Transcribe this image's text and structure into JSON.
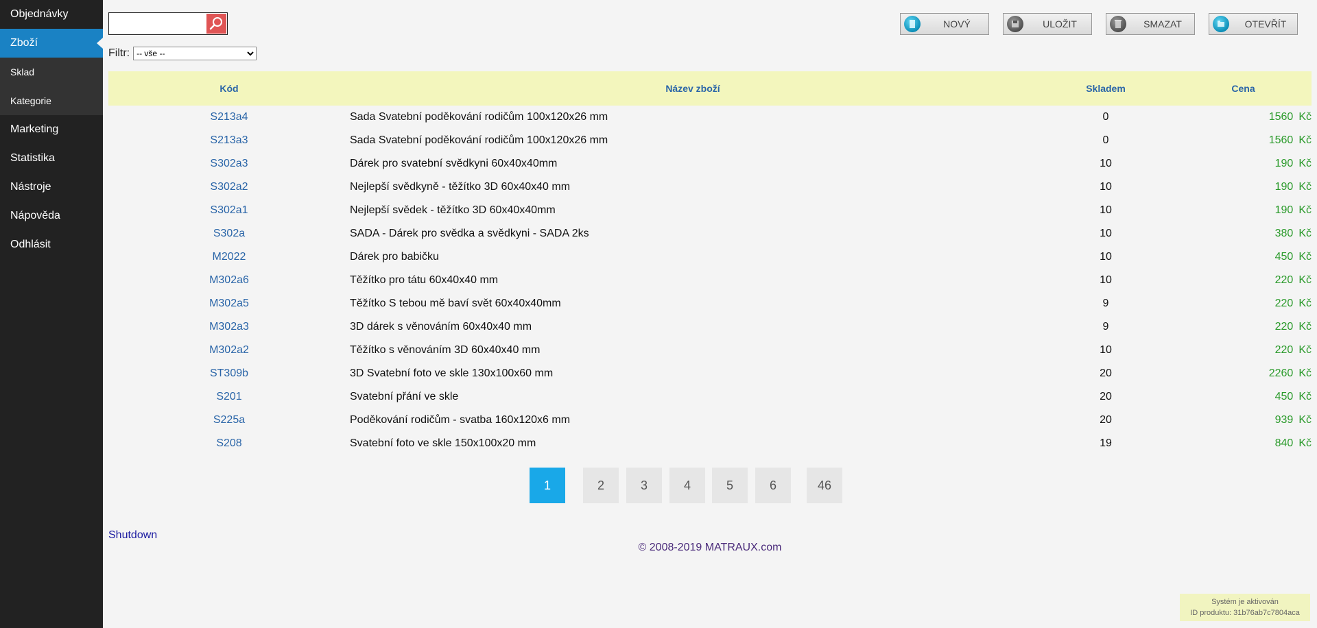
{
  "sidebar": {
    "items": [
      {
        "label": "Objednávky"
      },
      {
        "label": "Zboží"
      },
      {
        "label": "Sklad"
      },
      {
        "label": "Kategorie"
      },
      {
        "label": "Marketing"
      },
      {
        "label": "Statistika"
      },
      {
        "label": "Nástroje"
      },
      {
        "label": "Nápověda"
      },
      {
        "label": "Odhlásit"
      }
    ]
  },
  "search": {
    "value": "",
    "icon": "search-icon"
  },
  "filter": {
    "label": "Filtr:",
    "selected": "-- vše --"
  },
  "toolbar": {
    "new_label": "NOVÝ",
    "save_label": "ULOŽIT",
    "delete_label": "SMAZAT",
    "open_label": "OTEVŘÍT"
  },
  "table": {
    "headers": {
      "code": "Kód",
      "name": "Název zboží",
      "stock": "Skladem",
      "price": "Cena"
    },
    "currency": "Kč",
    "rows": [
      {
        "code": "S213a4",
        "name": "Sada Svatební poděkování rodičům 100x120x26 mm",
        "stock": "0",
        "price": "1560"
      },
      {
        "code": "S213a3",
        "name": "Sada Svatební poděkování rodičům 100x120x26 mm",
        "stock": "0",
        "price": "1560"
      },
      {
        "code": "S302a3",
        "name": "Dárek pro svatební svědkyni 60x40x40mm",
        "stock": "10",
        "price": "190"
      },
      {
        "code": "S302a2",
        "name": "Nejlepší svědkyně - těžítko 3D 60x40x40 mm",
        "stock": "10",
        "price": "190"
      },
      {
        "code": "S302a1",
        "name": "Nejlepší svědek - těžítko 3D 60x40x40mm",
        "stock": "10",
        "price": "190"
      },
      {
        "code": "S302a",
        "name": "SADA - Dárek pro svědka a svědkyni - SADA 2ks",
        "stock": "10",
        "price": "380"
      },
      {
        "code": "M2022",
        "name": "Dárek pro babičku",
        "stock": "10",
        "price": "450"
      },
      {
        "code": "M302a6",
        "name": "Těžítko pro tátu 60x40x40 mm",
        "stock": "10",
        "price": "220"
      },
      {
        "code": "M302a5",
        "name": "Těžítko S tebou mě baví svět 60x40x40mm",
        "stock": "9",
        "price": "220"
      },
      {
        "code": "M302a3",
        "name": "3D dárek s věnováním 60x40x40 mm",
        "stock": "9",
        "price": "220"
      },
      {
        "code": "M302a2",
        "name": "Těžítko s věnováním 3D 60x40x40 mm",
        "stock": "10",
        "price": "220"
      },
      {
        "code": "ST309b",
        "name": "3D Svatební foto ve skle 130x100x60 mm",
        "stock": "20",
        "price": "2260"
      },
      {
        "code": "S201",
        "name": "Svatební přání ve skle",
        "stock": "20",
        "price": "450"
      },
      {
        "code": "S225a",
        "name": "Poděkování rodičům - svatba 160x120x6 mm",
        "stock": "20",
        "price": "939"
      },
      {
        "code": "S208",
        "name": "Svatební foto ve skle 150x100x20 mm",
        "stock": "19",
        "price": "840"
      }
    ]
  },
  "pagination": {
    "pages": [
      "1",
      "2",
      "3",
      "4",
      "5",
      "6",
      "46"
    ],
    "current": "1"
  },
  "footer": {
    "shutdown": "Shutdown",
    "copyright": "© 2008-2019 MATRAUX.com",
    "status_line1": "Systém je aktivován",
    "status_line2": "ID produktu: 31b76ab7c7804aca"
  }
}
